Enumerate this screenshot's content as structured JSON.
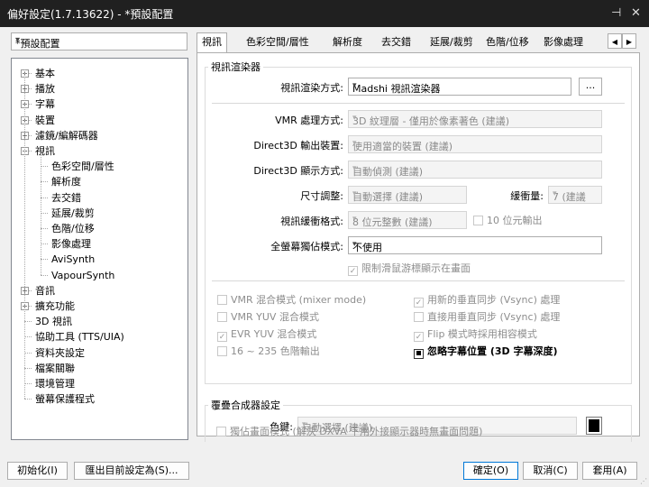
{
  "window": {
    "title": "偏好設定(1.7.13622) - *預設配置",
    "pin_glyph": "⊣",
    "close_glyph": "✕"
  },
  "preset": {
    "value": "*預設配置"
  },
  "tree": {
    "items": [
      {
        "label": "基本",
        "expander": "+"
      },
      {
        "label": "播放",
        "expander": "+"
      },
      {
        "label": "字幕",
        "expander": "+"
      },
      {
        "label": "裝置",
        "expander": "+"
      },
      {
        "label": "濾鏡/編解碼器",
        "expander": "+"
      },
      {
        "label": "視訊",
        "expander": "−"
      },
      {
        "label": "色彩空間/層性"
      },
      {
        "label": "解析度"
      },
      {
        "label": "去交錯"
      },
      {
        "label": "延展/裁剪"
      },
      {
        "label": "色階/位移"
      },
      {
        "label": "影像處理"
      },
      {
        "label": "AviSynth"
      },
      {
        "label": "VapourSynth"
      },
      {
        "label": "音訊",
        "expander": "+"
      },
      {
        "label": "擴充功能",
        "expander": "+"
      },
      {
        "label": "3D 視訊"
      },
      {
        "label": "協助工具 (TTS/UIA)"
      },
      {
        "label": "資料夾設定"
      },
      {
        "label": "檔案關聯"
      },
      {
        "label": "環境管理"
      },
      {
        "label": "螢幕保護程式"
      }
    ]
  },
  "tabs": [
    "視訊",
    "色彩空間/層性",
    "解析度",
    "去交錯",
    "延展/裁剪",
    "色階/位移",
    "影像處理"
  ],
  "tab_scroll": {
    "left": "◀",
    "right": "▶"
  },
  "renderer_group": {
    "title": "視訊渲染器",
    "render_method_label": "視訊渲染方式:",
    "render_method_value": "Madshi 視訊渲染器",
    "more_button": "...",
    "vmr_label": "VMR 處理方式:",
    "vmr_value": "3D 紋理層 - 僅用於像素著色 (建議)",
    "d3d_output_label": "Direct3D 輸出裝置:",
    "d3d_output_value": "使用適當的裝置 (建議)",
    "d3d_display_label": "Direct3D 顯示方式:",
    "d3d_display_value": "自動偵測 (建議)",
    "size_label": "尺寸調整:",
    "size_value": "自動選擇 (建議)",
    "buffer_label": "緩衝量:",
    "buffer_value": "7 (建議",
    "format_label": "視訊緩衝格式:",
    "format_value": "8 位元整數 (建議)",
    "tenbit_label": "10 位元輸出",
    "fullscreen_label": "全螢幕獨佔模式:",
    "fullscreen_value": "不使用",
    "limit_cursor_label": "限制滑鼠游標顯示在畫面",
    "options": [
      {
        "label": "VMR 混合模式 (mixer mode)",
        "checked": false
      },
      {
        "label": "用新的垂直同步 (Vsync) 處理",
        "checked": true
      },
      {
        "label": "VMR YUV 混合模式",
        "checked": false
      },
      {
        "label": "直接用垂直同步 (Vsync) 處理",
        "checked": false
      },
      {
        "label": "EVR YUV 混合模式",
        "checked": true
      },
      {
        "label": "Flip 模式時採用相容模式",
        "checked": true
      },
      {
        "label": "16 ~ 235 色階輸出",
        "checked": false
      },
      {
        "label": "忽略字幕位置 (3D 字幕深度)",
        "checked": true
      }
    ]
  },
  "compositor_group": {
    "title": "覆疊合成器設定",
    "color_key_label": "色鍵:",
    "color_key_value": "自動選擇 (建議)",
    "color_key_swatch": "#000000",
    "exclusive_label": "獨佔畫面模式 (解決 DXVA 下用外接顯示器時無畫面問題)"
  },
  "icons": {
    "dropdown": "▾",
    "check": "✓",
    "grip": "⋰"
  },
  "buttons": {
    "reset": "初始化(I)",
    "export": "匯出目前設定為(S)...",
    "ok": "確定(O)",
    "cancel": "取消(C)",
    "apply": "套用(A)"
  },
  "colors": {
    "titlebar": "#202020",
    "accent": "#0078d7"
  }
}
